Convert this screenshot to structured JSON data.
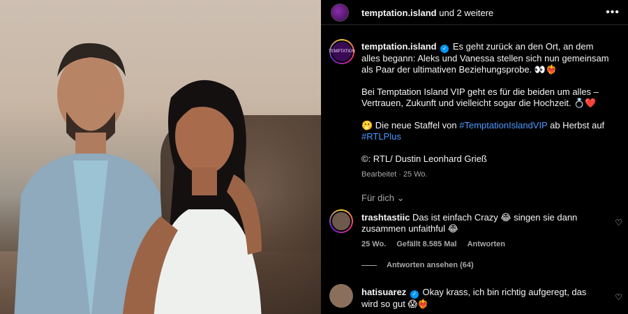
{
  "header": {
    "username": "temptation.island",
    "suffix": " und 2 weitere"
  },
  "caption": {
    "username": "temptation.island",
    "para1": " Es geht zurück an den Ort, an dem alles begann: Aleks und Vanessa stellen sich nun gemeinsam als Paar der ultimativen Beziehungsprobe. 👀❤️‍🔥",
    "para2": "Bei Temptation Island VIP geht es für die beiden um alles – Vertrauen, Zukunft und vielleicht sogar die Hochzeit. 💍❤️",
    "para3_prefix": "🫢 Die neue Staffel von ",
    "hashtag1": "#TemptationIslandVIP",
    "para3_mid": " ab Herbst auf ",
    "hashtag2": "#RTLPlus",
    "credit": "©: RTL/ Dustin Leonhard Grieß",
    "edited": "Bearbeitet · 25 Wo."
  },
  "filter": "Für dich",
  "comments": [
    {
      "username": "trashtastiic",
      "text": " Das ist einfach Crazy 😂 singen sie dann zusammen unfaithful 😂",
      "age": "25 Wo.",
      "likes": "Gefällt 8.585 Mal",
      "reply": "Antworten",
      "view_replies": "Antworten ansehen (64)"
    },
    {
      "username": "hatisuarez",
      "text": " Okay krass, ich bin richtig aufgeregt, das wird so gut 😱❤️‍🔥"
    }
  ],
  "icons": [
    "more-options-icon",
    "verified-icon",
    "heart-icon",
    "chevron-down-icon"
  ],
  "colors": {
    "link": "#4c9aff",
    "verified": "#0095f6",
    "muted": "#a8a8a8"
  }
}
